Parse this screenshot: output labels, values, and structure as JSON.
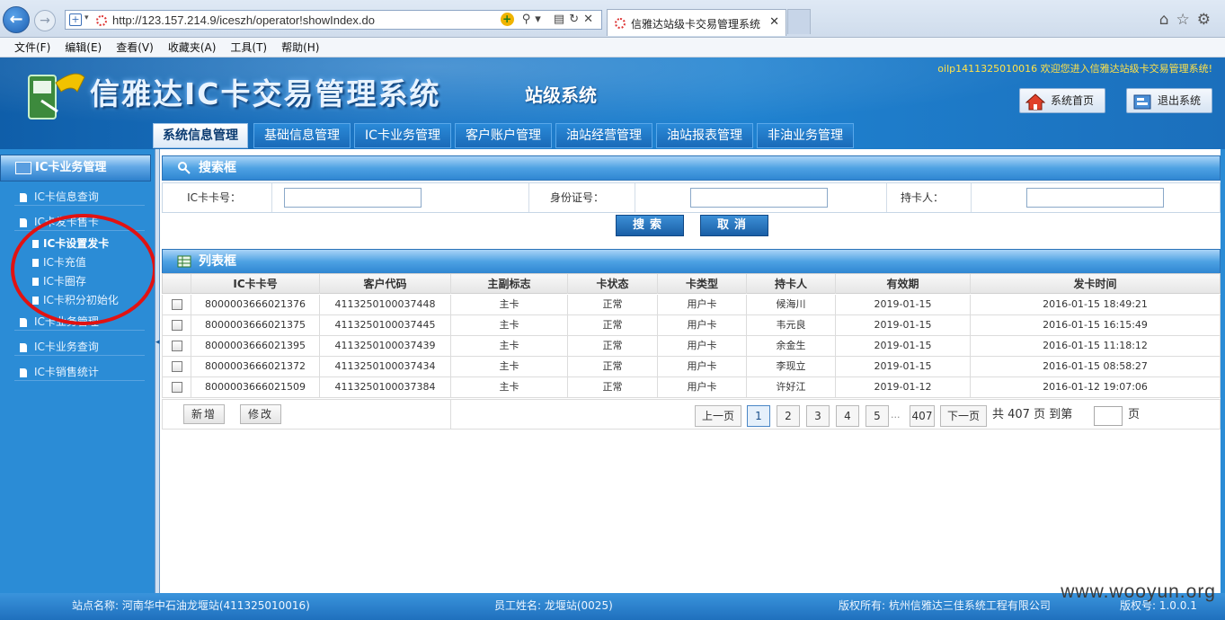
{
  "browser": {
    "url": "http://123.157.214.9/iceszh/operator!showIndex.do",
    "tab_title": "信雅达站级卡交易管理系统",
    "menu": [
      "文件(F)",
      "编辑(E)",
      "查看(V)",
      "收藏夹(A)",
      "工具(T)",
      "帮助(H)"
    ]
  },
  "header": {
    "title": "信雅达IC卡交易管理系统",
    "subtitle": "站级系统",
    "welcome": "oilp1411325010016 欢迎您进入信雅达站级卡交易管理系统!",
    "home_label": "系统首页",
    "logout_label": "退出系统"
  },
  "nav": {
    "tabs": [
      "系统信息管理",
      "基础信息管理",
      "IC卡业务管理",
      "客户账户管理",
      "油站经营管理",
      "油站报表管理",
      "非油业务管理"
    ],
    "active": "系统信息管理"
  },
  "sidebar": {
    "title": "IC卡业务管理",
    "items": [
      "IC卡信息查询",
      "IC卡发卡售卡",
      "IC卡业务管理",
      "IC卡业务查询",
      "IC卡销售统计"
    ],
    "sub_items": [
      "IC卡设置发卡",
      "IC卡充值",
      "IC卡圈存",
      "IC卡积分初始化"
    ],
    "active_sub": "IC卡设置发卡"
  },
  "search": {
    "title": "搜索框",
    "fields": [
      {
        "label": "IC卡卡号：",
        "value": ""
      },
      {
        "label": "身份证号：",
        "value": ""
      },
      {
        "label": "持卡人：",
        "value": ""
      }
    ],
    "search_label": "搜索",
    "cancel_label": "取消"
  },
  "list": {
    "title": "列表框",
    "columns": [
      "IC卡卡号",
      "客户代码",
      "主副标志",
      "卡状态",
      "卡类型",
      "持卡人",
      "有效期",
      "发卡时间"
    ],
    "rows": [
      [
        "8000003666021376",
        "4113250100037448",
        "主卡",
        "正常",
        "用户卡",
        "候海川",
        "2019-01-15",
        "2016-01-15 18:49:21"
      ],
      [
        "8000003666021375",
        "4113250100037445",
        "主卡",
        "正常",
        "用户卡",
        "韦元良",
        "2019-01-15",
        "2016-01-15 16:15:49"
      ],
      [
        "8000003666021395",
        "4113250100037439",
        "主卡",
        "正常",
        "用户卡",
        "余金生",
        "2019-01-15",
        "2016-01-15 11:18:12"
      ],
      [
        "8000003666021372",
        "4113250100037434",
        "主卡",
        "正常",
        "用户卡",
        "李现立",
        "2019-01-15",
        "2016-01-15 08:58:27"
      ],
      [
        "8000003666021509",
        "4113250100037384",
        "主卡",
        "正常",
        "用户卡",
        "许好江",
        "2019-01-12",
        "2016-01-12 19:07:06"
      ]
    ],
    "add_label": "新增",
    "edit_label": "修改",
    "pager": {
      "prev": "上一页",
      "pages": [
        "1",
        "2",
        "3",
        "4",
        "5"
      ],
      "ellipsis": "...",
      "last": "407",
      "next": "下一页",
      "summary": "共 407 页 到第",
      "page_suffix": "页",
      "current": 1
    }
  },
  "footer": {
    "station": "站点名称: 河南华中石油龙堰站(411325010016)",
    "employee": "员工姓名: 龙堰站(0025)",
    "copyright": "版权所有: 杭州信雅达三佳系统工程有限公司",
    "version": "版权号: 1.0.0.1",
    "watermark": "www.wooyun.org"
  },
  "colors": {
    "header_blue": "#1d78c7",
    "sidebar_blue": "#2b8cd6",
    "highlight_red": "#e11212",
    "welcome_yellow": "#ffe24a"
  }
}
